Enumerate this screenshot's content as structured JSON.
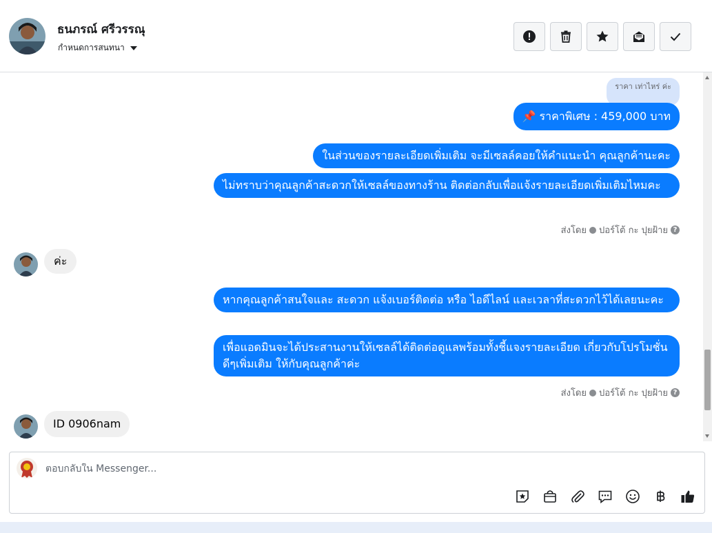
{
  "header": {
    "contact_name": "ธนภรณ์ ศรีวรรณุ",
    "conversation_settings": "กำหนดการสนทนา",
    "toolbar": [
      {
        "icon": "exclamation-icon"
      },
      {
        "icon": "trash-icon"
      },
      {
        "icon": "star-icon"
      },
      {
        "icon": "mail-icon"
      },
      {
        "icon": "check-icon"
      }
    ]
  },
  "thread": {
    "quoted_text": "ราคา เท่าไหร่ ค่ะ",
    "price_message": "📌 ราคาพิเศษ : 459,000 บาท",
    "out_group_1": [
      "ในส่วนของรายละเอียดเพิ่มเติม จะมีเซลล์คอยให้คำแนะนำ คุณลูกค้านะคะ",
      "ไม่ทราบว่าคุณลูกค้าสะดวกให้เซลล์ของทางร้าน ติดต่อกลับเพื่อแจ้งรายละเอียดเพิ่มเติมไหมคะ"
    ],
    "sent_by_1": {
      "prefix": "ส่งโดย",
      "name": "ปอร์โต้ กะ ปุยฝ้าย"
    },
    "in_1": "ค่ะ",
    "out_group_2": [
      "หากคุณลูกค้าสนใจและ สะดวก แจ้งเบอร์ติดต่อ หรือ ไอดีไลน์ และเวลาที่สะดวกไว้ได้เลยนะคะ",
      "เพื่อแอดมินจะได้ประสานงานให้เซลล์ได้ติดต่อดูแลพร้อมทั้งชี้แจงรายละเอียด เกี่ยวกับโปรโมชั่นดีๆเพิ่มเติม ให้กับคุณลูกค้าค่ะ"
    ],
    "sent_by_2": {
      "prefix": "ส่งโดย",
      "name": "ปอร์โต้ กะ ปุยฝ้าย"
    },
    "in_2": "ID 0906nam"
  },
  "composer": {
    "placeholder": "ตอบกลับใน Messenger...",
    "tools": [
      "sticker-star-icon",
      "bag-icon",
      "paperclip-icon",
      "chat-icon",
      "smiley-icon",
      "baht-icon",
      "like-icon"
    ]
  },
  "colors": {
    "outgoing": "#0a7cff",
    "incoming": "#f0f0f0",
    "quote": "#d6e4fb"
  }
}
